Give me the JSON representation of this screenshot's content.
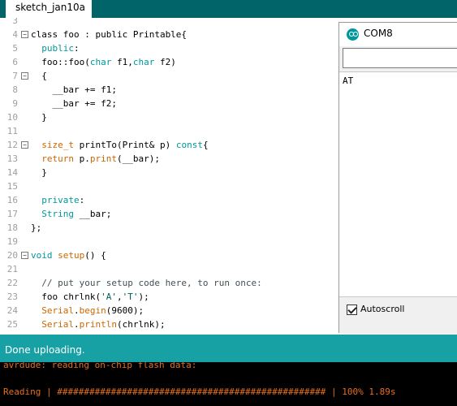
{
  "editor": {
    "tab_label": "sketch_jan10a",
    "lines": [
      {
        "num": "3",
        "fold": false,
        "tokens": []
      },
      {
        "num": "4",
        "fold": true,
        "tokens": [
          {
            "t": "class foo : public Printable{",
            "c": "plain"
          }
        ]
      },
      {
        "num": "5",
        "fold": false,
        "tokens": [
          {
            "t": "  ",
            "c": "plain"
          },
          {
            "t": "public",
            "c": "kw"
          },
          {
            "t": ":",
            "c": "plain"
          }
        ]
      },
      {
        "num": "6",
        "fold": false,
        "tokens": [
          {
            "t": "  foo::foo(",
            "c": "plain"
          },
          {
            "t": "char",
            "c": "kw"
          },
          {
            "t": " f1,",
            "c": "plain"
          },
          {
            "t": "char",
            "c": "kw"
          },
          {
            "t": " f2)",
            "c": "plain"
          }
        ]
      },
      {
        "num": "7",
        "fold": true,
        "tokens": [
          {
            "t": "  {",
            "c": "plain"
          }
        ]
      },
      {
        "num": "8",
        "fold": false,
        "tokens": [
          {
            "t": "    __bar += f1;",
            "c": "plain"
          }
        ]
      },
      {
        "num": "9",
        "fold": false,
        "tokens": [
          {
            "t": "    __bar += f2;",
            "c": "plain"
          }
        ]
      },
      {
        "num": "10",
        "fold": false,
        "tokens": [
          {
            "t": "  }",
            "c": "plain"
          }
        ]
      },
      {
        "num": "11",
        "fold": false,
        "tokens": []
      },
      {
        "num": "12",
        "fold": true,
        "tokens": [
          {
            "t": "  ",
            "c": "plain"
          },
          {
            "t": "size_t",
            "c": "ty"
          },
          {
            "t": " printTo(Print& p) ",
            "c": "plain"
          },
          {
            "t": "const",
            "c": "kw"
          },
          {
            "t": "{",
            "c": "plain"
          }
        ]
      },
      {
        "num": "13",
        "fold": false,
        "tokens": [
          {
            "t": "  ",
            "c": "plain"
          },
          {
            "t": "return",
            "c": "ty"
          },
          {
            "t": " p.",
            "c": "plain"
          },
          {
            "t": "print",
            "c": "ty"
          },
          {
            "t": "(__bar);",
            "c": "plain"
          }
        ]
      },
      {
        "num": "14",
        "fold": false,
        "tokens": [
          {
            "t": "  }",
            "c": "plain"
          }
        ]
      },
      {
        "num": "15",
        "fold": false,
        "tokens": []
      },
      {
        "num": "16",
        "fold": false,
        "tokens": [
          {
            "t": "  ",
            "c": "plain"
          },
          {
            "t": "private",
            "c": "kw"
          },
          {
            "t": ":",
            "c": "plain"
          }
        ]
      },
      {
        "num": "17",
        "fold": false,
        "tokens": [
          {
            "t": "  ",
            "c": "plain"
          },
          {
            "t": "String",
            "c": "kw"
          },
          {
            "t": " __bar;",
            "c": "plain"
          }
        ]
      },
      {
        "num": "18",
        "fold": false,
        "tokens": [
          {
            "t": "};",
            "c": "plain"
          }
        ]
      },
      {
        "num": "19",
        "fold": false,
        "tokens": []
      },
      {
        "num": "20",
        "fold": true,
        "tokens": [
          {
            "t": "void",
            "c": "kw"
          },
          {
            "t": " ",
            "c": "plain"
          },
          {
            "t": "setup",
            "c": "ty"
          },
          {
            "t": "() {",
            "c": "plain"
          }
        ]
      },
      {
        "num": "21",
        "fold": false,
        "tokens": []
      },
      {
        "num": "22",
        "fold": false,
        "tokens": [
          {
            "t": "  // put your setup code here, to run once:",
            "c": "cm"
          }
        ]
      },
      {
        "num": "23",
        "fold": false,
        "tokens": [
          {
            "t": "  foo chrlnk(",
            "c": "plain"
          },
          {
            "t": "'A'",
            "c": "st"
          },
          {
            "t": ",",
            "c": "plain"
          },
          {
            "t": "'T'",
            "c": "st"
          },
          {
            "t": ");",
            "c": "plain"
          }
        ]
      },
      {
        "num": "24",
        "fold": false,
        "tokens": [
          {
            "t": "  ",
            "c": "plain"
          },
          {
            "t": "Serial",
            "c": "ty"
          },
          {
            "t": ".",
            "c": "plain"
          },
          {
            "t": "begin",
            "c": "ty"
          },
          {
            "t": "(9600);",
            "c": "plain"
          }
        ]
      },
      {
        "num": "25",
        "fold": false,
        "tokens": [
          {
            "t": "  ",
            "c": "plain"
          },
          {
            "t": "Serial",
            "c": "ty"
          },
          {
            "t": ".",
            "c": "plain"
          },
          {
            "t": "println",
            "c": "ty"
          },
          {
            "t": "(chrlnk);",
            "c": "plain"
          }
        ]
      }
    ]
  },
  "serial_monitor": {
    "title": "COM8",
    "input_value": "",
    "output": "AT",
    "autoscroll_label": "Autoscroll",
    "autoscroll_checked": true
  },
  "status": {
    "message": "Done uploading."
  },
  "console": {
    "lines": [
      "avrdude: reading on-chip flash data:",
      "Reading | ################################################## | 100% 1.89s"
    ]
  },
  "colors": {
    "tabbar": "#006468",
    "status": "#17a1a5",
    "console_text": "#e4701e",
    "keyword": "#00979c",
    "function": "#cc6600"
  }
}
